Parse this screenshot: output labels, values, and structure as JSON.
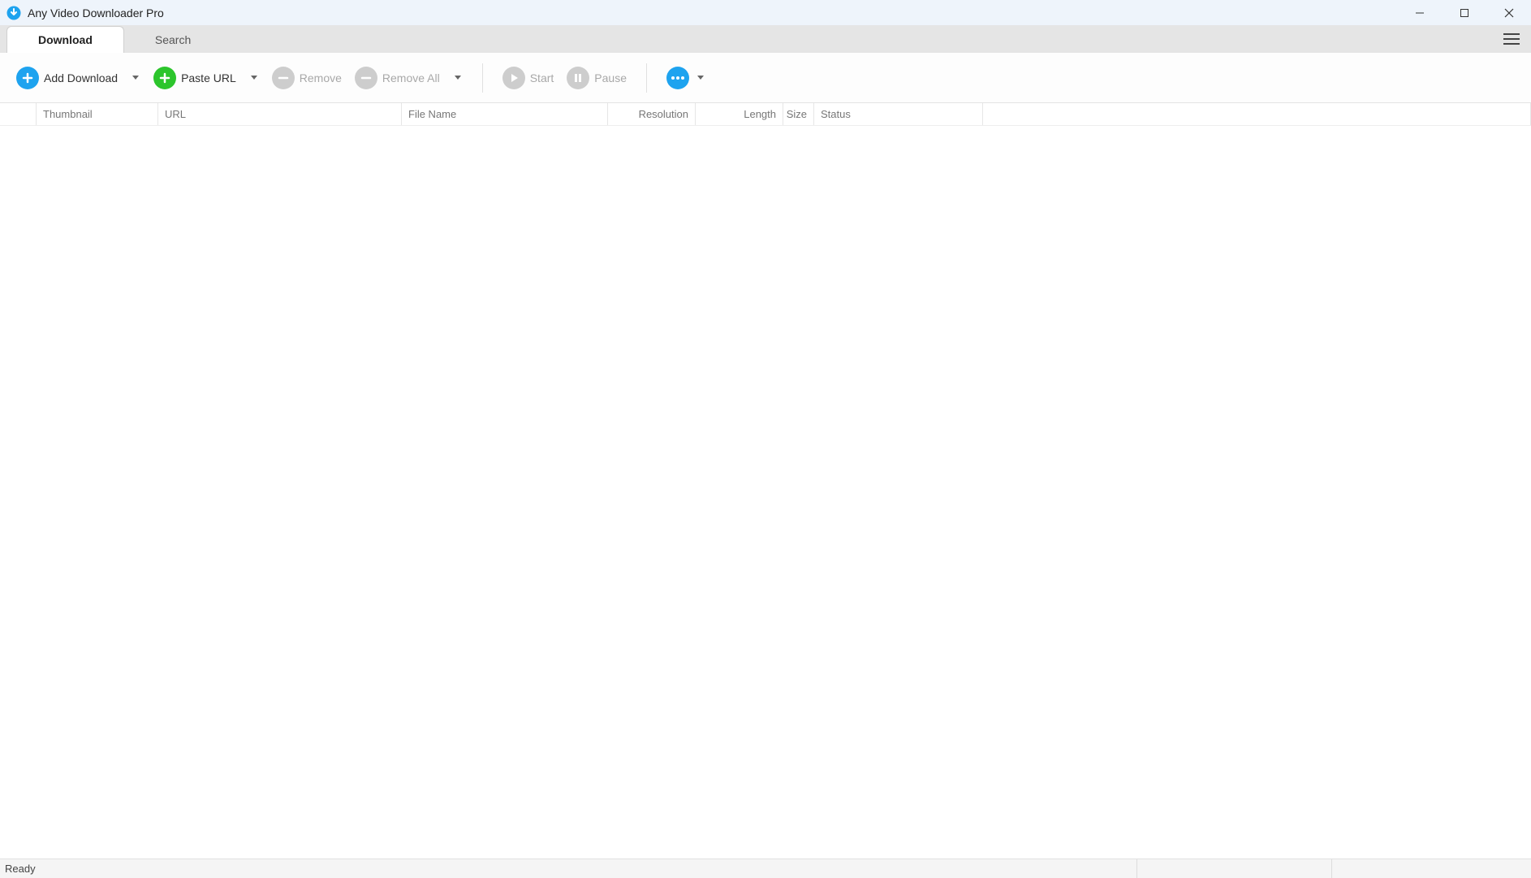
{
  "app": {
    "title": "Any Video Downloader Pro"
  },
  "tabs": {
    "download": "Download",
    "search": "Search"
  },
  "toolbar": {
    "add_download": "Add Download",
    "paste_url": "Paste URL",
    "remove": "Remove",
    "remove_all": "Remove All",
    "start": "Start",
    "pause": "Pause"
  },
  "columns": {
    "thumbnail": "Thumbnail",
    "url": "URL",
    "filename": "File Name",
    "resolution": "Resolution",
    "length": "Length",
    "size": "Size",
    "status": "Status"
  },
  "status": {
    "text": "Ready"
  }
}
